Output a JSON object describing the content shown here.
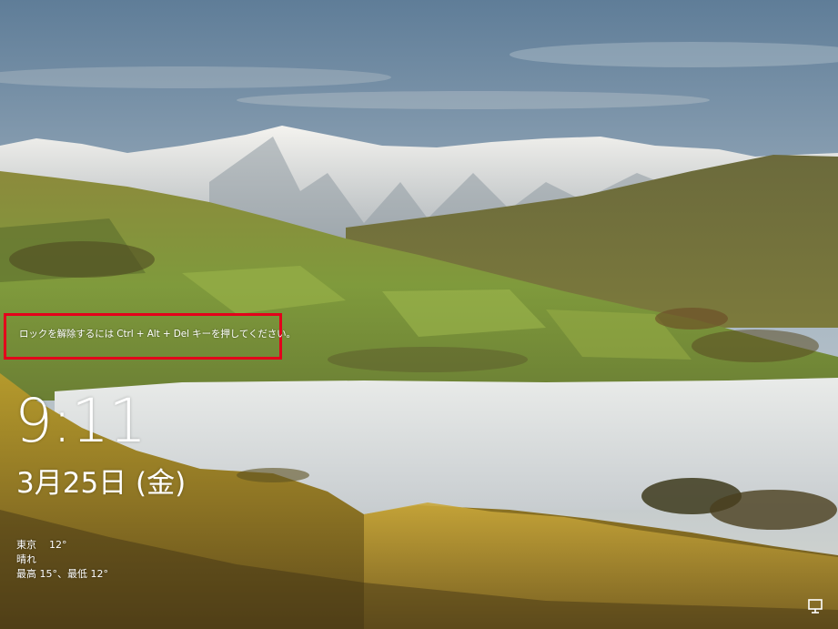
{
  "lock_screen": {
    "hint_text": "ロックを解除するには Ctrl + Alt + Del キーを押してください。",
    "time": "9:11",
    "date": "3月25日 (金)"
  },
  "weather": {
    "location": "東京",
    "temperature": "12°",
    "condition": "晴れ",
    "high_low": "最高 15°、最低 12°"
  },
  "icons": {
    "network": "network-icon"
  },
  "colors": {
    "highlight_border": "#e3001b",
    "text": "#ffffff"
  }
}
